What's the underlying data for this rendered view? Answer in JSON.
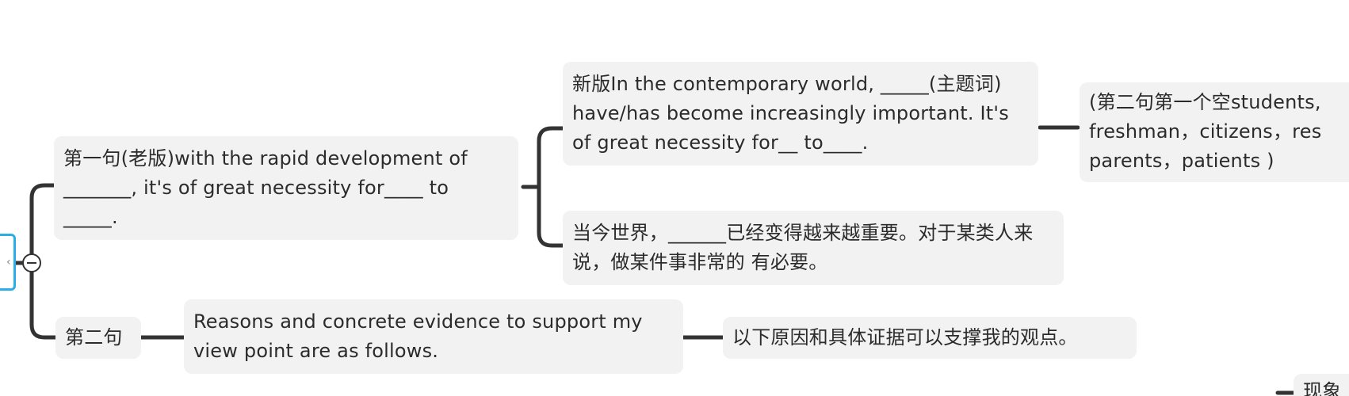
{
  "mindmap": {
    "branch1": {
      "label": "第一句(老版)with the rapid development of _______, it's of great necessity for____ to _____.",
      "children": [
        {
          "label": "新版In the contemporary world, _____(主题词) have/has become increasingly important. It's of great necessity for__ to____.",
          "note": "(第二句第一个空students, freshman，citizens，res parents，patients )"
        },
        {
          "label": "当今世界，______已经变得越来越重要。对于某类人来说，做某件事非常的 有必要。"
        }
      ]
    },
    "branch2": {
      "label": "第二句",
      "english": "Reasons and concrete evidence to support my view point are as follows.",
      "chinese": "以下原因和具体证据可以支撑我的观点。"
    },
    "partial_bottom_node": "现象"
  },
  "colors": {
    "connector": "#333333",
    "node_bg": "#f2f2f2",
    "root_border": "#29aee6"
  }
}
